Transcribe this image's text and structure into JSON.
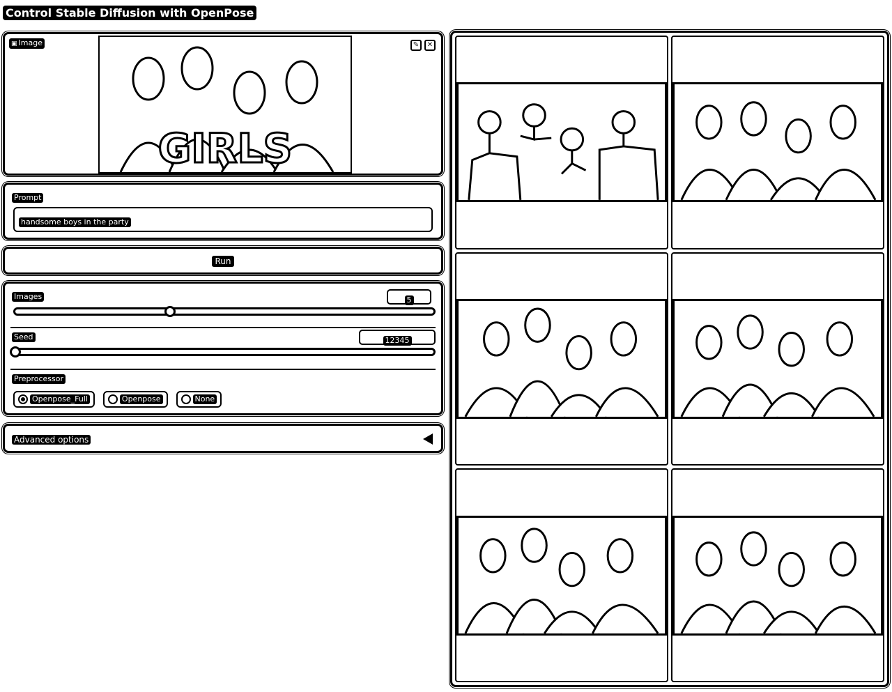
{
  "app": {
    "title": "Control Stable Diffusion with OpenPose"
  },
  "image_input": {
    "label": "Image",
    "label_icon": "image-icon",
    "edit_icon": "pencil-icon",
    "clear_icon": "close-icon",
    "preview_text": "GIRLS"
  },
  "prompt": {
    "label": "Prompt",
    "value": "handsome boys in the party"
  },
  "run": {
    "label": "Run"
  },
  "controls": {
    "images": {
      "label": "Images",
      "value": "5",
      "slider_fraction": 0.37
    },
    "seed": {
      "label": "Seed",
      "value": "12345",
      "slider_fraction": 0.0
    },
    "preprocessor": {
      "label": "Preprocessor",
      "options": [
        "Openpose_Full",
        "Openpose",
        "None"
      ],
      "selected": "Openpose_Full"
    }
  },
  "advanced": {
    "label": "Advanced options",
    "icon": "triangle-left-icon"
  },
  "gallery": {
    "items": [
      {
        "kind": "pose-skeleton"
      },
      {
        "kind": "generated-photo"
      },
      {
        "kind": "generated-photo"
      },
      {
        "kind": "generated-photo"
      },
      {
        "kind": "generated-photo"
      },
      {
        "kind": "generated-photo"
      }
    ]
  }
}
